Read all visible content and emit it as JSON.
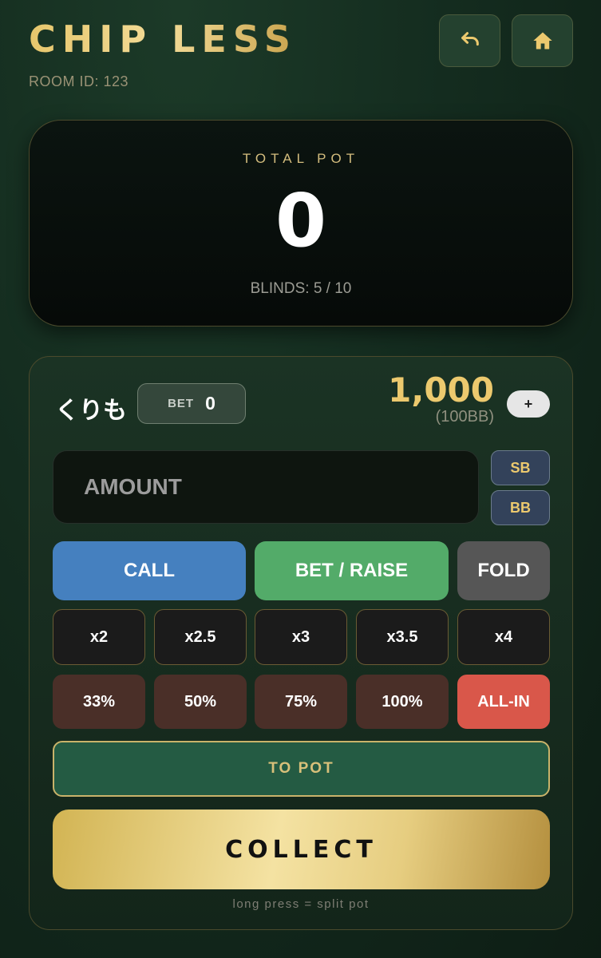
{
  "app": {
    "title": "CHIP LESS",
    "room_id": "ROOM ID: 123"
  },
  "header": {
    "undo_icon": "undo-icon",
    "home_icon": "home-icon"
  },
  "pot": {
    "label": "TOTAL POT",
    "value": "0",
    "blinds": "BLINDS: 5 / 10"
  },
  "player": {
    "name": "くりも",
    "bet_label": "BET",
    "bet_value": "0",
    "stack": "1,000",
    "stack_bb": "(100BB)",
    "add_label": "+"
  },
  "amount": {
    "placeholder": "AMOUNT"
  },
  "blind_buttons": {
    "sb": "SB",
    "bb": "BB"
  },
  "actions": {
    "call": "CALL",
    "bet_raise": "BET / RAISE",
    "fold": "FOLD"
  },
  "multipliers": [
    "x2",
    "x2.5",
    "x3",
    "x3.5",
    "x4"
  ],
  "percents": [
    "33%",
    "50%",
    "75%",
    "100%",
    "ALL-IN"
  ],
  "to_pot": "TO POT",
  "collect": "COLLECT",
  "hint": "long press = split pot",
  "colors": {
    "gold": "#ecc96e",
    "call": "#4580bf",
    "bet_raise": "#53ab69",
    "fold": "#565656",
    "all_in": "#d9574a"
  }
}
